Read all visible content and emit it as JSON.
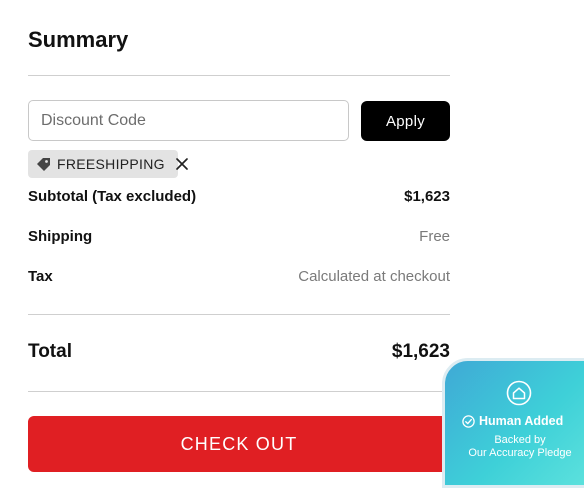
{
  "summary": {
    "title": "Summary",
    "discount": {
      "placeholder": "Discount Code",
      "value": "",
      "apply_label": "Apply"
    },
    "applied_code": {
      "icon": "tag-icon",
      "label": "FREESHIPPING",
      "remove_icon": "close-icon"
    },
    "lines": [
      {
        "label": "Subtotal (Tax excluded)",
        "value": "$1,623"
      },
      {
        "label": "Shipping",
        "value": "Free"
      },
      {
        "label": "Tax",
        "value": "Calculated at checkout"
      }
    ],
    "total": {
      "label": "Total",
      "value": "$1,623"
    },
    "checkout_label": "CHECK OUT"
  },
  "badge": {
    "icon": "house-icon",
    "title": "Human Added",
    "title_icon": "check-circle-icon",
    "subtitle_line1": "Backed by",
    "subtitle_line2": "Our Accuracy Pledge"
  },
  "colors": {
    "checkout": "#e01f23",
    "apply": "#000000",
    "tag_bg": "#e3e3e3",
    "badge": "#3ed0d8"
  }
}
